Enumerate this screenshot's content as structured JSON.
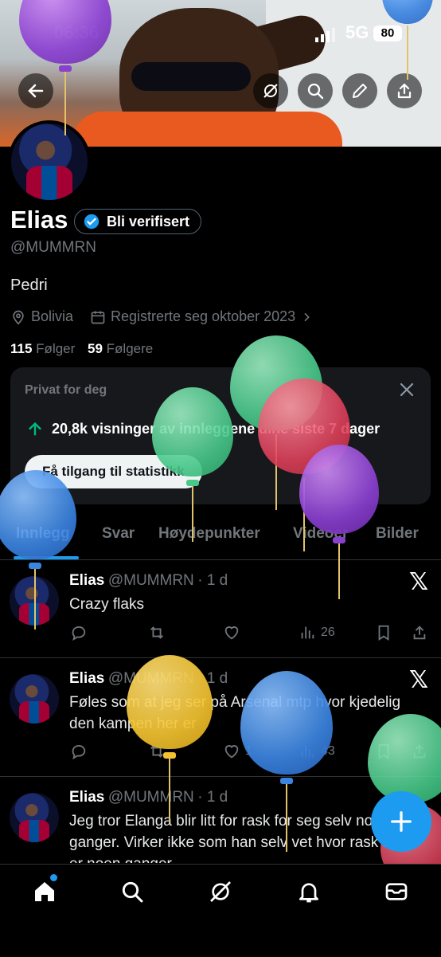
{
  "status_bar": {
    "time": "06:36",
    "network": "5G",
    "battery": "80"
  },
  "profile": {
    "name": "Elias",
    "verify_label": "Bli verifisert",
    "handle": "@MUMMRN",
    "bio": "Pedri",
    "location": "Bolivia",
    "joined": "Registrerte seg oktober 2023",
    "following_count": "115",
    "following_label": "Følger",
    "followers_count": "59",
    "followers_label": "Følgere"
  },
  "insights_card": {
    "title": "Privat for deg",
    "stat": "20,8k visninger av innleggene dine siste 7 dager",
    "button": "Få tilgang til statistikk"
  },
  "tabs": [
    "Innlegg",
    "Svar",
    "Høydepunkter",
    "Videoer",
    "Bilder"
  ],
  "posts": [
    {
      "name": "Elias",
      "handle": "@MUMMRN",
      "time": "· 1 d",
      "text": "Crazy flaks",
      "views": "26",
      "likes": ""
    },
    {
      "name": "Elias",
      "handle": "@MUMMRN",
      "time": "· 1 d",
      "text": "Føles som at jeg ser på Arsenal mtp hvor kjedelig den kampen her er",
      "views": "43",
      "likes": "1"
    },
    {
      "name": "Elias",
      "handle": "@MUMMRN",
      "time": "· 1 d",
      "text": "Jeg tror Elanga blir litt for rask for seg selv noen ganger. Virker ikke som han selv vet hvor rask han er noen ganger",
      "views": "",
      "likes": ""
    }
  ],
  "icons": {
    "back": "arrow-left-icon",
    "grok": "grok-icon",
    "search": "search-icon",
    "edit": "pencil-icon",
    "share": "share-icon",
    "location": "location-pin-icon",
    "calendar": "calendar-icon",
    "close": "close-icon",
    "arrow_up": "arrow-up-icon",
    "reply": "reply-icon",
    "retweet": "retweet-icon",
    "like": "heart-icon",
    "views": "views-icon",
    "bookmark": "bookmark-icon",
    "x": "x-logo-icon",
    "compose": "plus-icon",
    "home": "home-icon",
    "notifications": "bell-icon",
    "messages": "mail-icon"
  },
  "colors": {
    "accent": "#1d9bf0",
    "green_arrow": "#00ba7c",
    "background": "#000000"
  },
  "balloons": [
    "purple",
    "blue",
    "green",
    "green",
    "red",
    "purple",
    "blue",
    "yellow",
    "blue",
    "green",
    "red"
  ]
}
